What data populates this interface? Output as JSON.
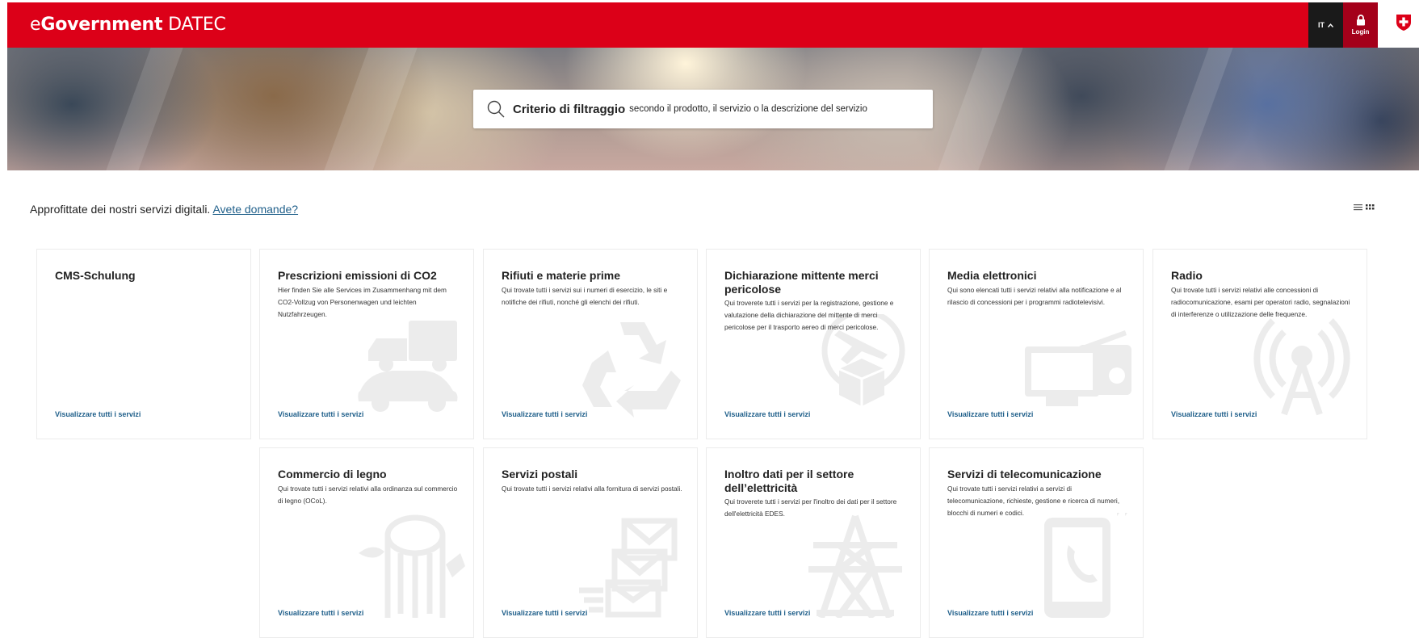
{
  "header": {
    "logo_e": "e",
    "logo_government": "Government",
    "logo_dept": "DATEC",
    "lang_label": "IT",
    "login_label": "Login"
  },
  "search": {
    "label": "Criterio di filtraggio",
    "hint": "secondo il prodotto, il servizio o la descrizione del servizio"
  },
  "intro": {
    "text": "Approfittate dei nostri servizi digitali.",
    "link": "Avete domande?"
  },
  "cards": [
    {
      "title": "CMS-Schulung",
      "desc": "",
      "link": "Visualizzare tutti i servizi",
      "icon": "none"
    },
    {
      "title": "Prescrizioni emissioni di CO2",
      "desc": "Hier finden Sie alle Services im Zusammenhang mit dem CO2-Vollzug von Personenwagen und leichten Nutzfahrzeugen.",
      "link": "Visualizzare tutti i servizi",
      "icon": "vehicles-icon"
    },
    {
      "title": "Rifiuti e materie prime",
      "desc": "Qui trovate tutti i servizi sui i numeri di esercizio, le siti e notifiche dei rifiuti, nonché gli elenchi dei rifiuti.",
      "link": "Visualizzare tutti i servizi",
      "icon": "recycle-icon"
    },
    {
      "title": "Dichiarazione mittente merci pericolose",
      "desc": "Qui troverete tutti i servizi per la registrazione, gestione e valutazione della dichiarazione del mittente di merci pericolose per il trasporto aereo di merci pericolose.",
      "link": "Visualizzare tutti i servizi",
      "icon": "airfreight-icon"
    },
    {
      "title": "Media elettronici",
      "desc": "Qui sono elencati tutti i servizi relativi alla notificazione e al rilascio di concessioni per i programmi radiotelevisivi.",
      "link": "Visualizzare tutti i servizi",
      "icon": "media-icon"
    },
    {
      "title": "Radio",
      "desc": "Qui trovate tutti i servizi relativi alle concessioni di radiocomunicazione, esami per operatori radio, segnalazioni di interferenze o utilizzazione delle frequenze.",
      "link": "Visualizzare tutti i servizi",
      "icon": "antenna-icon"
    },
    {
      "title": "Commercio di legno",
      "desc": "Qui trovate tutti i servizi relativi alla ordinanza sul commercio di legno (OCoL).",
      "link": "Visualizzare tutti i servizi",
      "icon": "log-icon"
    },
    {
      "title": "Servizi postali",
      "desc": "Qui trovate tutti i servizi relativi alla fornitura di servizi postali.",
      "link": "Visualizzare tutti i servizi",
      "icon": "mail-icon"
    },
    {
      "title": "Inoltro dati per il settore dell’elettricità",
      "desc": "Qui troverete tutti i servizi per l'inoltro dei dati per il settore dell'elettricità EDES.",
      "link": "Visualizzare tutti i servizi",
      "icon": "pylon-icon"
    },
    {
      "title": "Servizi di telecomunicazione",
      "desc": "Qui trovate tutti i servizi relativi a servizi di telecomunicazione, richieste, gestione e ricerca di numeri, blocchi di numeri e codici.",
      "link": "Visualizzare tutti i servizi",
      "icon": "phone-icon"
    }
  ]
}
